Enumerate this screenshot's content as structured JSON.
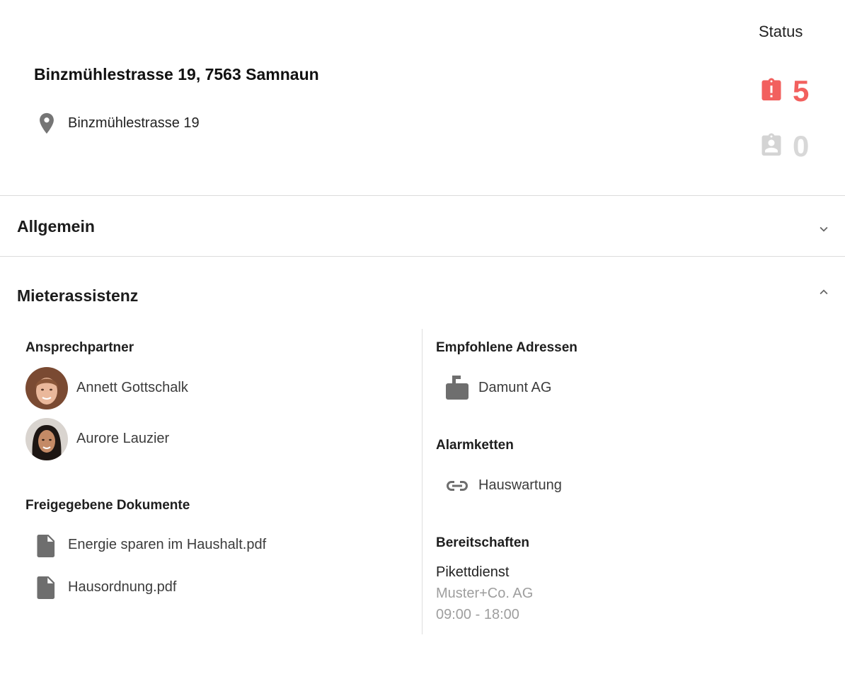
{
  "header": {
    "title": "Binzmühlestrasse 19, 7563 Samnaun",
    "location": "Binzmühlestrasse 19",
    "status": {
      "label": "Status",
      "open_count": "5",
      "closed_count": "0",
      "open_color": "#f2605e",
      "closed_color": "#d8d8d8"
    }
  },
  "sections": {
    "general": {
      "title": "Allgemein",
      "state": "collapsed"
    },
    "tenant_assist": {
      "title": "Mieterassistenz",
      "state": "expanded"
    }
  },
  "contacts": {
    "title": "Ansprechpartner",
    "people": [
      {
        "name": "Annett Gottschalk"
      },
      {
        "name": "Aurore Lauzier"
      }
    ]
  },
  "documents": {
    "title": "Freigegebene Dokumente",
    "files": [
      {
        "name": "Energie sparen im Haushalt.pdf",
        "icon": "file-icon"
      },
      {
        "name": "Hausordnung.pdf",
        "icon": "file-icon"
      }
    ]
  },
  "recommended": {
    "title": "Empfohlene Adressen",
    "items": [
      {
        "name": "Damunt AG",
        "icon": "business-icon"
      }
    ]
  },
  "alarm_chains": {
    "title": "Alarmketten",
    "items": [
      {
        "name": "Hauswartung",
        "icon": "link-icon"
      }
    ]
  },
  "standby": {
    "title": "Bereitschaften",
    "service": "Pikettdienst",
    "company": "Muster+Co. AG",
    "hours": "09:00 - 18:00"
  }
}
